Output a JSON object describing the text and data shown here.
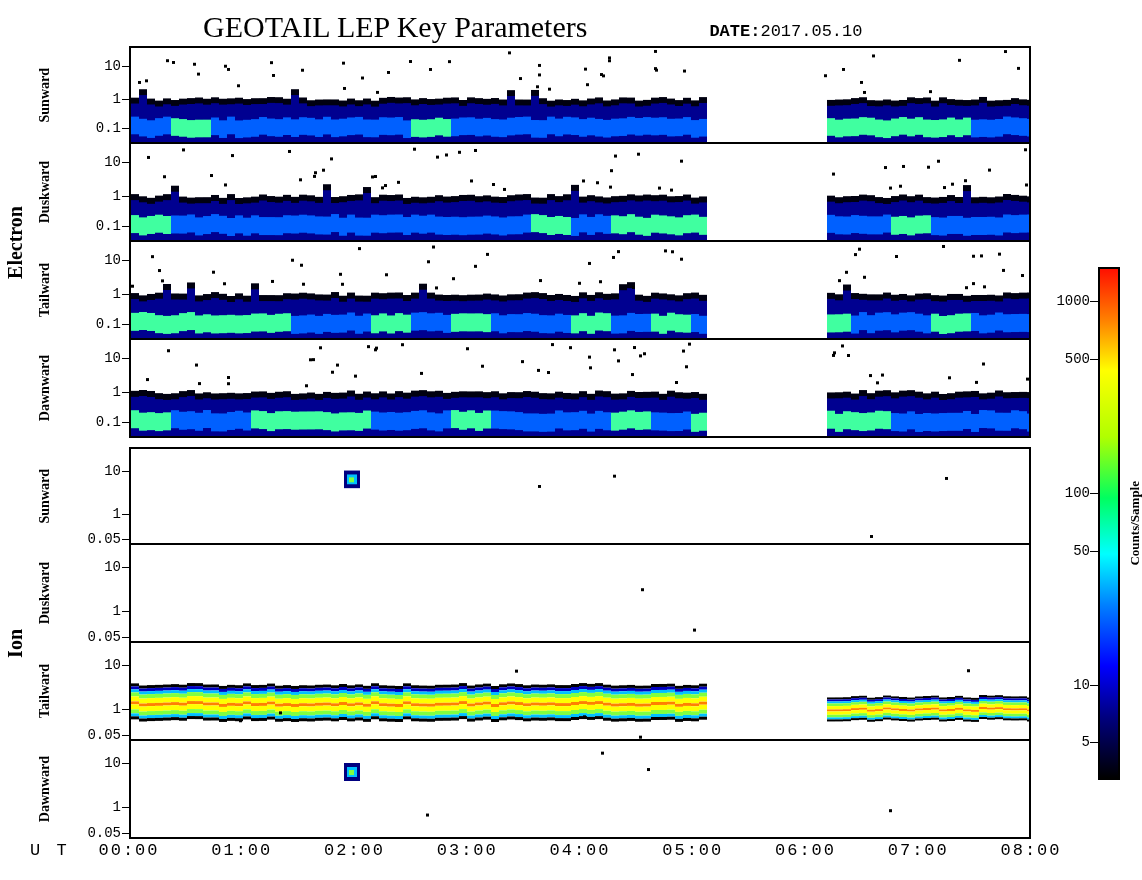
{
  "title": "GEOTAIL LEP Key Parameters",
  "date": "**DATE:**2017.05.10",
  "groups": [
    {
      "label": "Electron",
      "kind": "electron",
      "panels": [
        {
          "label": "Sunward",
          "kind": "electron-band",
          "ticks": [
            "10",
            "1",
            "0.1"
          ]
        },
        {
          "label": "Duskward",
          "kind": "electron-band",
          "ticks": [
            "10",
            "1",
            "0.1"
          ]
        },
        {
          "label": "Tailward",
          "kind": "electron-band",
          "ticks": [
            "10",
            "1",
            "0.1"
          ]
        },
        {
          "label": "Dawnward",
          "kind": "electron-band",
          "ticks": [
            "10",
            "1",
            "0.1"
          ]
        }
      ]
    },
    {
      "label": "Ion",
      "kind": "ion",
      "panels": [
        {
          "label": "Sunward",
          "kind": "blob",
          "ticks": [
            "10",
            "1",
            "0.05"
          ]
        },
        {
          "label": "Duskward",
          "kind": "empty",
          "ticks": [
            "10",
            "1",
            "0.05"
          ]
        },
        {
          "label": "Tailward",
          "kind": "ion-band",
          "ticks": [
            "10",
            "1",
            "0.05"
          ]
        },
        {
          "label": "Dawnward",
          "kind": "blob",
          "ticks": [
            "10",
            "1",
            "0.05"
          ]
        }
      ]
    }
  ],
  "colorbar": {
    "title": "Counts/Sample",
    "ticks": [
      "1000",
      "500",
      "100",
      "50",
      "10",
      "5"
    ]
  },
  "time_axis": {
    "unit": "U T",
    "labels": [
      "00:00",
      "01:00",
      "02:00",
      "03:00",
      "04:00",
      "05:00",
      "06:00",
      "07:00",
      "08:00"
    ]
  }
}
